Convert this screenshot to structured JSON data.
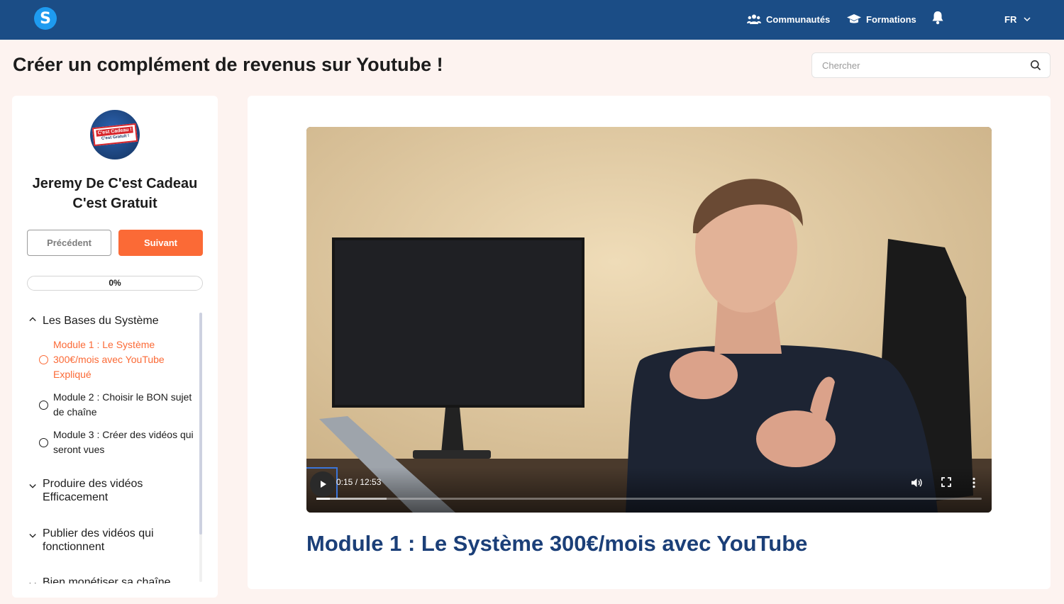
{
  "header": {
    "logo_letter": "S",
    "nav": {
      "communities": "Communautés",
      "formations": "Formations",
      "language": "FR"
    }
  },
  "page": {
    "title": "Créer un complément de revenus sur Youtube !"
  },
  "search": {
    "placeholder": "Chercher"
  },
  "sidebar": {
    "avatar_line1": "C'est Cadeau !",
    "avatar_line2": "C'est Gratuit !",
    "author": "Jeremy De C'est Cadeau C'est Gratuit",
    "prev_label": "Précédent",
    "next_label": "Suivant",
    "progress_label": "0%",
    "progress_fraction": 0,
    "sections": [
      {
        "title": "Les Bases du Système",
        "expanded": true,
        "lessons": [
          {
            "title": "Module 1 : Le Système 300€/mois avec YouTube Expliqué",
            "active": true
          },
          {
            "title": "Module 2 : Choisir le BON sujet de chaîne",
            "active": false
          },
          {
            "title": "Module 3 : Créer des vidéos qui seront vues",
            "active": false
          }
        ]
      },
      {
        "title": "Produire des vidéos Efficacement",
        "expanded": false
      },
      {
        "title": "Publier des vidéos qui fonctionnent",
        "expanded": false
      },
      {
        "title": "Bien monétiser sa chaîne",
        "expanded": false
      }
    ]
  },
  "video": {
    "time": "0:15 / 12:53",
    "played_fraction": 0.02,
    "buffered_fraction": 0.106
  },
  "main": {
    "module_title": "Module 1 : Le Système 300€/mois avec YouTube"
  },
  "colors": {
    "header": "#1b4d86",
    "accent": "#fb6a36",
    "title_blue": "#1b3f78",
    "background": "#fdf3f0"
  },
  "icons": [
    "logo-icon",
    "users-icon",
    "graduation-cap-icon",
    "bell-icon",
    "chevron-down-icon",
    "search-icon",
    "chevron-up-icon",
    "radio-circle-icon",
    "play-icon",
    "volume-icon",
    "fullscreen-icon",
    "more-vertical-icon"
  ]
}
